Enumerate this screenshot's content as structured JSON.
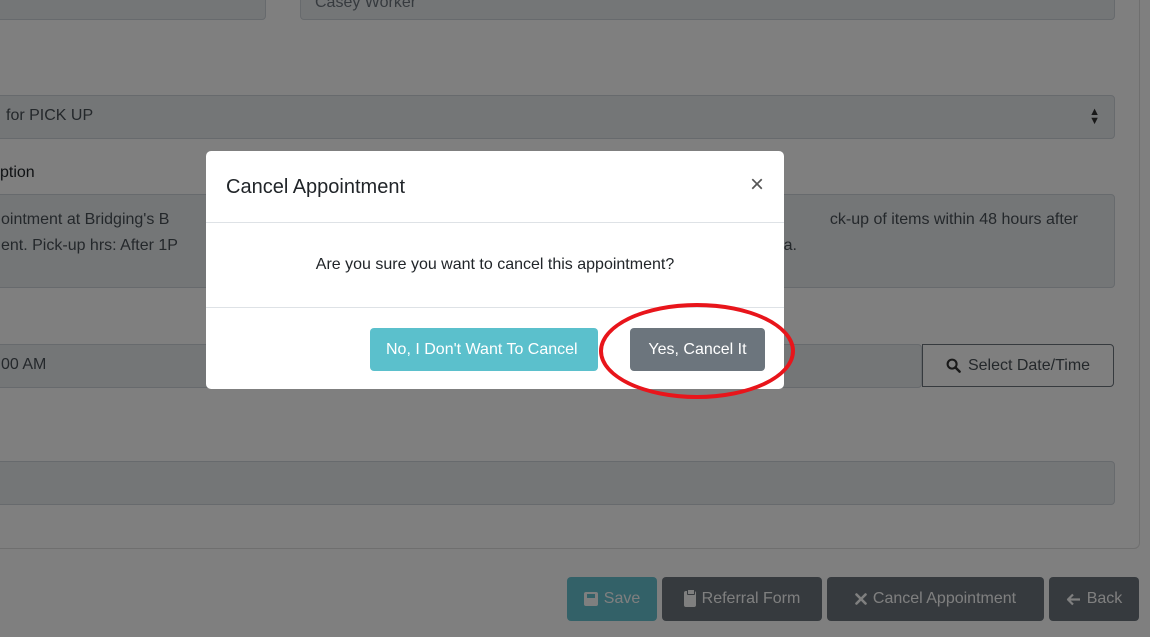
{
  "form": {
    "worker_value": "Casey Worker",
    "appointment_type_value": "for PICK UP",
    "description_label": "ption",
    "description_line1": "ointment at Bridging's B",
    "description_line1_right": "ck-up of items within 48 hours after",
    "description_line2": "ent. Pick-up hrs: After 1P",
    "description_line2_right": "a.",
    "datetime_value": "00 AM",
    "select_datetime_label": "Select Date/Time"
  },
  "actions": {
    "save_label": "Save",
    "referral_label": "Referral Form",
    "cancel_label": "Cancel Appointment",
    "back_label": "Back"
  },
  "modal": {
    "title": "Cancel Appointment",
    "close_glyph": "×",
    "message": "Are you sure you want to cancel this appointment?",
    "no_label": "No, I Don't Want To Cancel",
    "yes_label": "Yes, Cancel It"
  },
  "icons": {
    "select_caret": "up-down-caret-icon",
    "search": "search-icon",
    "save": "save-icon",
    "clipboard": "clipboard-icon",
    "times": "times-icon",
    "arrow_left": "arrow-left-icon"
  },
  "colors": {
    "info": "#17a2b8",
    "secondary": "#6c757d",
    "annotation": "#e8151b"
  }
}
